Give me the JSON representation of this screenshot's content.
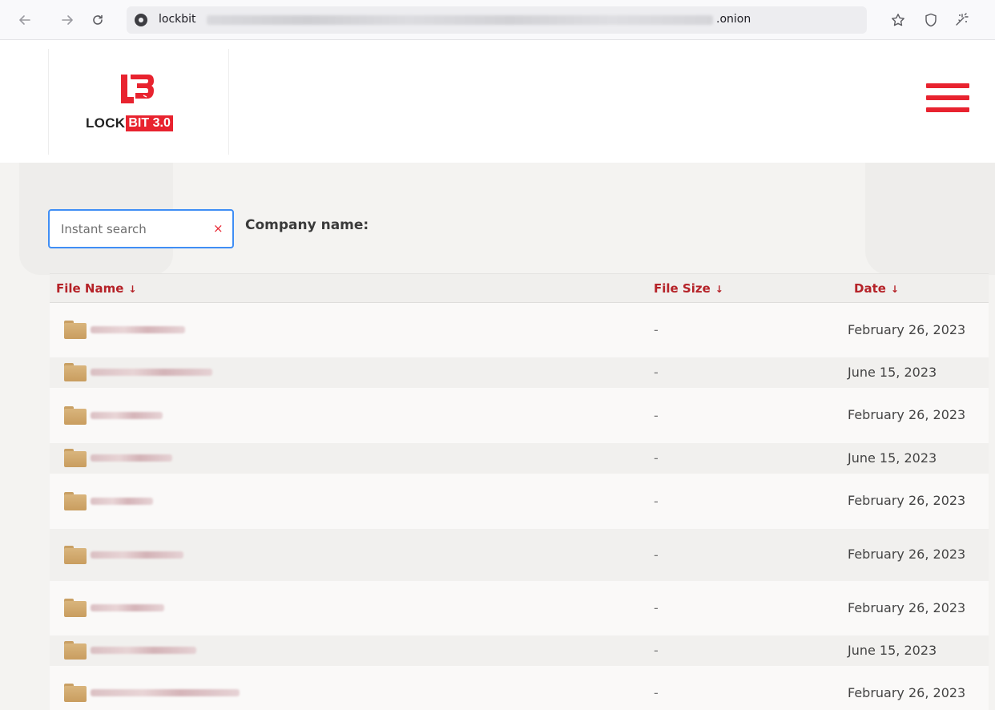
{
  "browser": {
    "url_prefix": "lockbit",
    "url_suffix": ".onion",
    "icons": [
      "back-icon",
      "forward-icon",
      "reload-icon",
      "site-identity-icon",
      "bookmark-star-icon",
      "shield-icon",
      "extension-icon"
    ]
  },
  "logo": {
    "word_main": "LOCK",
    "word_accent": "BIT 3.0",
    "accent_color": "#e8232f"
  },
  "search": {
    "placeholder": "Instant search",
    "clear_label": "×",
    "company_label": "Company name:"
  },
  "table": {
    "headers": {
      "name": "File Name",
      "size": "File Size",
      "date": "Date",
      "sort_arrow": "↓"
    },
    "rows": [
      {
        "size": "-",
        "date": "February 26, 2023"
      },
      {
        "size": "-",
        "date": "June 15, 2023"
      },
      {
        "size": "-",
        "date": "February 26, 2023"
      },
      {
        "size": "-",
        "date": "June 15, 2023"
      },
      {
        "size": "-",
        "date": "February 26, 2023"
      },
      {
        "size": "-",
        "date": "February 26, 2023"
      },
      {
        "size": "-",
        "date": "February 26, 2023"
      },
      {
        "size": "-",
        "date": "June 15, 2023"
      },
      {
        "size": "-",
        "date": "February 26, 2023"
      }
    ]
  },
  "colors": {
    "accent_red": "#e8232f",
    "header_text": "#b52228",
    "search_focus": "#3f8ef5",
    "folder": "#d4ae74"
  }
}
